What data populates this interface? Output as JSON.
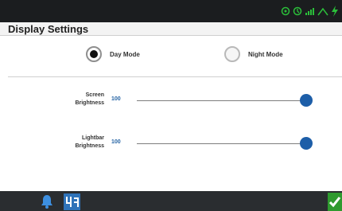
{
  "app": {
    "title": "Display Settings"
  },
  "colors": {
    "status_bar": "#1b1d1f",
    "bottom_bar": "#2a2d30",
    "accent_blue": "#1d5ea8",
    "value_blue": "#2563a4",
    "status_green": "#2bbf3a",
    "confirm_green": "#2f9a2f"
  },
  "status_bar": {
    "icons": [
      "gps-icon",
      "satellite-icon",
      "signal-icon",
      "steering-icon",
      "lightning-icon"
    ]
  },
  "mode": {
    "selected": "day",
    "options": [
      {
        "id": "day",
        "label": "Day Mode",
        "checked": true
      },
      {
        "id": "night",
        "label": "Night Mode",
        "checked": false
      }
    ]
  },
  "sliders": {
    "screen": {
      "label_line1": "Screen",
      "label_line2": "Brightness",
      "value": "100",
      "level": 100
    },
    "lightbar": {
      "label_line1": "Lightbar",
      "label_line2": "Brightness",
      "value": "100",
      "level": 100
    }
  },
  "bottom_bar": {
    "icons": [
      "bell-icon",
      "map-icon"
    ],
    "confirm_icon": "checkmark-icon"
  }
}
